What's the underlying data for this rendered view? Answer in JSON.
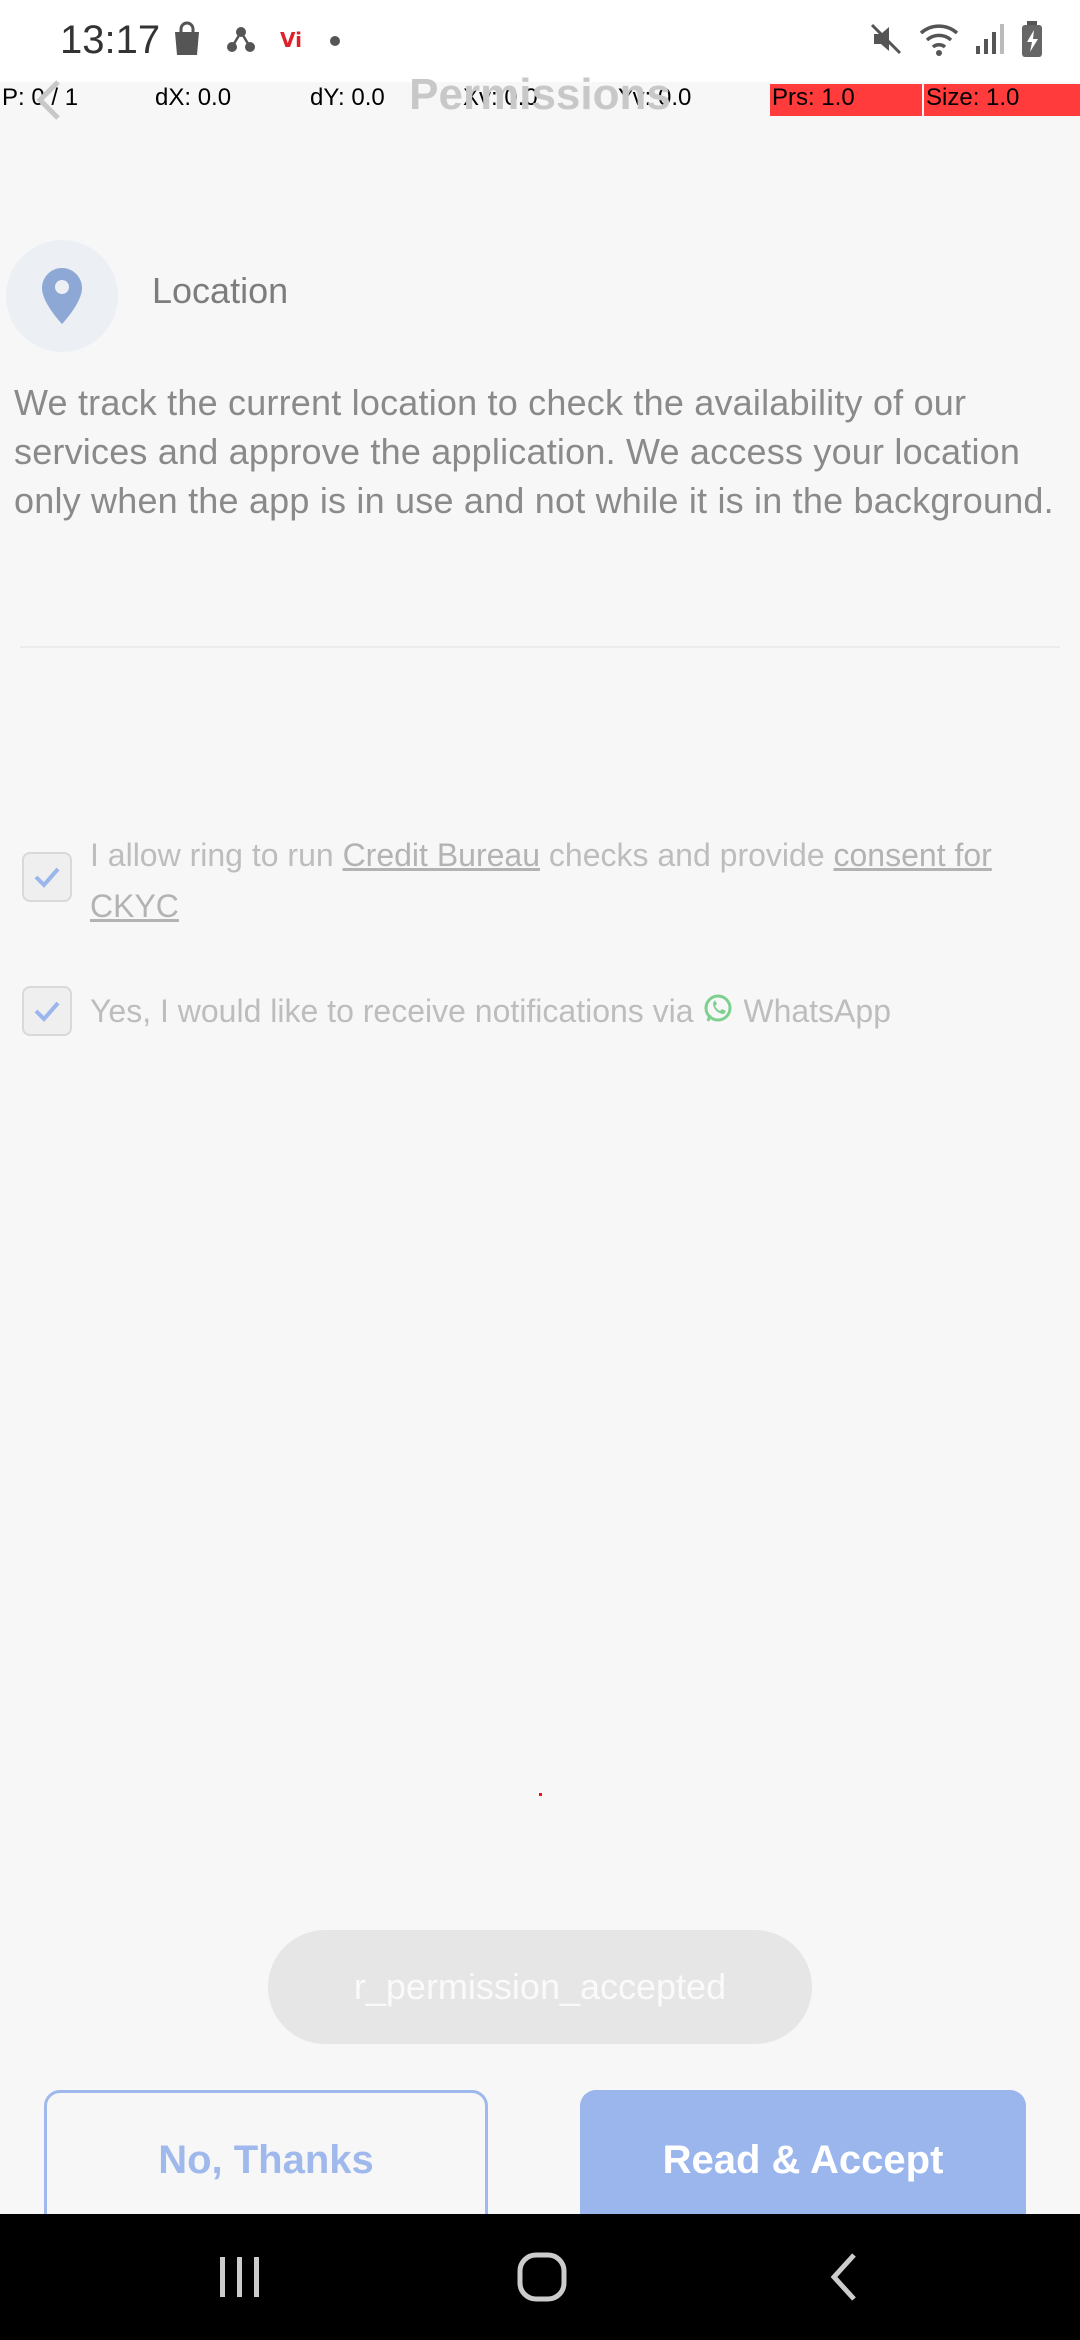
{
  "status_bar": {
    "time": "13:17",
    "left_icons": [
      "shopping-bag-icon",
      "share-nodes-icon",
      "vi-logo-icon",
      "dot-icon"
    ],
    "right_icons": [
      "mute-icon",
      "wifi-icon",
      "signal-icon",
      "battery-charging-icon"
    ]
  },
  "debug_overlay": {
    "pointer": "P: 0 / 1",
    "dx": "dX: 0.0",
    "dy": "dY: 0.0",
    "xv": "Xv: 0.0",
    "yv": "Yv: 0.0",
    "prs": "Prs: 1.0",
    "size": "Size: 1.0"
  },
  "header": {
    "title": "Permissions",
    "back_icon": "chevron-left-icon"
  },
  "permission": {
    "icon": "location-pin-icon",
    "label": "Location",
    "description": "We track the current location to check the availability of our services and approve the application. We access your location only when the app is in use and not while it is in the background."
  },
  "consents": {
    "credit": {
      "prefix": " I allow ring to run ",
      "link1": "Credit Bureau",
      "middle": " checks and provide ",
      "link2": "consent for CKYC",
      "checked": true
    },
    "whatsapp": {
      "prefix": "Yes, I would like to receive notifications via ",
      "suffix": " WhatsApp",
      "checked": true
    }
  },
  "toast": {
    "text": "r_permission_accepted"
  },
  "actions": {
    "decline": "No, Thanks",
    "accept": "Read & Accept"
  },
  "colors": {
    "accent": "#9ab6ec",
    "background": "#f7f7f7",
    "whatsapp": "#7ed08f"
  },
  "nav_bar": {
    "icons": [
      "recents-icon",
      "home-icon",
      "back-icon"
    ]
  }
}
